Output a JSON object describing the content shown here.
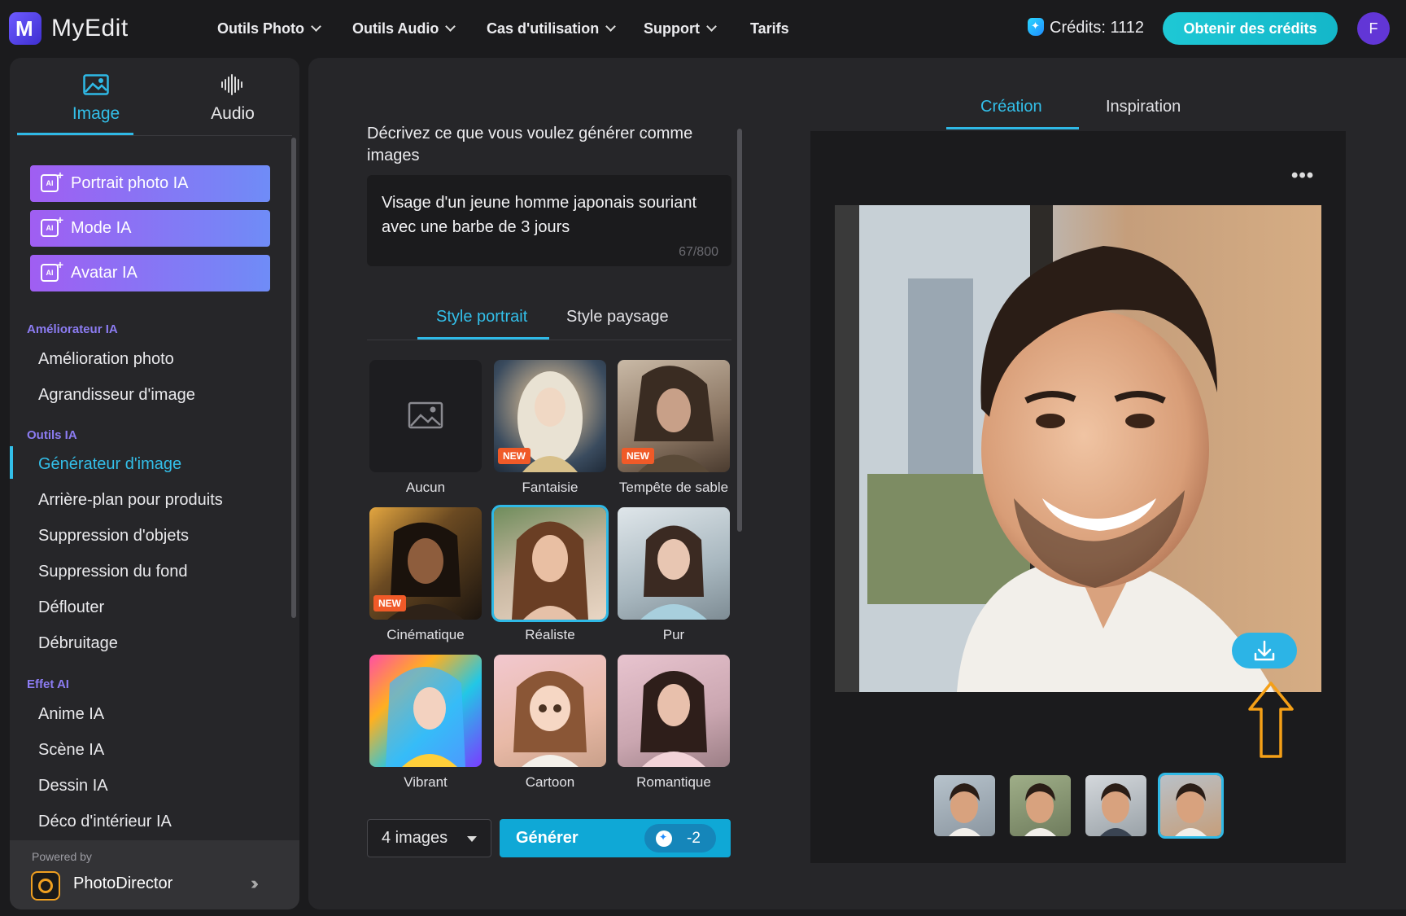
{
  "app": {
    "brand": "MyEdit",
    "nav": [
      {
        "label": "Outils Photo"
      },
      {
        "label": "Outils Audio"
      },
      {
        "label": "Cas d'utilisation"
      },
      {
        "label": "Support"
      },
      {
        "label": "Tarifs"
      }
    ],
    "credits_label": "Crédits: 1112",
    "get_credits": "Obtenir des crédits",
    "avatar_initial": "F"
  },
  "sidebar": {
    "mode_tabs": [
      {
        "label": "Image",
        "active": true
      },
      {
        "label": "Audio",
        "active": false
      }
    ],
    "ai_buttons": [
      {
        "label": "Portrait photo IA"
      },
      {
        "label": "Mode IA"
      },
      {
        "label": "Avatar IA"
      }
    ],
    "sections": [
      {
        "title": "Améliorateur IA",
        "items": [
          "Amélioration photo",
          "Agrandisseur d'image"
        ]
      },
      {
        "title": "Outils IA",
        "items": [
          "Générateur d'image",
          "Arrière-plan pour produits",
          "Suppression d'objets",
          "Suppression du fond",
          "Déflouter",
          "Débruitage"
        ]
      },
      {
        "title": "Effet AI",
        "items": [
          "Anime IA",
          "Scène IA",
          "Dessin IA",
          "Déco d'intérieur IA"
        ]
      }
    ],
    "active_item": "Générateur d'image",
    "powered_by": "Powered by",
    "powered_name": "PhotoDirector"
  },
  "generator": {
    "prompt_label": "Décrivez ce que vous voulez générer comme images",
    "prompt_text": "Visage d'un jeune homme japonais souriant avec une barbe de 3 jours",
    "prompt_count": "67/800",
    "style_tabs": [
      {
        "label": "Style portrait",
        "active": true
      },
      {
        "label": "Style paysage",
        "active": false
      }
    ],
    "styles": [
      {
        "label": "Aucun",
        "new": false
      },
      {
        "label": "Fantaisie",
        "new": true
      },
      {
        "label": "Tempête de sable",
        "new": true
      },
      {
        "label": "Cinématique",
        "new": true
      },
      {
        "label": "Réaliste",
        "new": false,
        "selected": true
      },
      {
        "label": "Pur",
        "new": false
      },
      {
        "label": "Vibrant",
        "new": false
      },
      {
        "label": "Cartoon",
        "new": false
      },
      {
        "label": "Romantique",
        "new": false
      }
    ],
    "new_badge": "NEW",
    "count_select": "4 images",
    "generate_label": "Générer",
    "generate_cost": "-2"
  },
  "preview": {
    "tabs": [
      {
        "label": "Création",
        "active": true
      },
      {
        "label": "Inspiration",
        "active": false
      }
    ],
    "more_label": "•••",
    "thumbnail_count": 4,
    "selected_thumbnail": 4
  },
  "colors": {
    "accent": "#2fb9e6",
    "sidebar_section": "#8c7cf2",
    "ai_button_from": "#a05ef2",
    "ai_button_to": "#6f8cf7",
    "new_badge": "#f05a28",
    "hint_arrow": "#f5a017"
  }
}
